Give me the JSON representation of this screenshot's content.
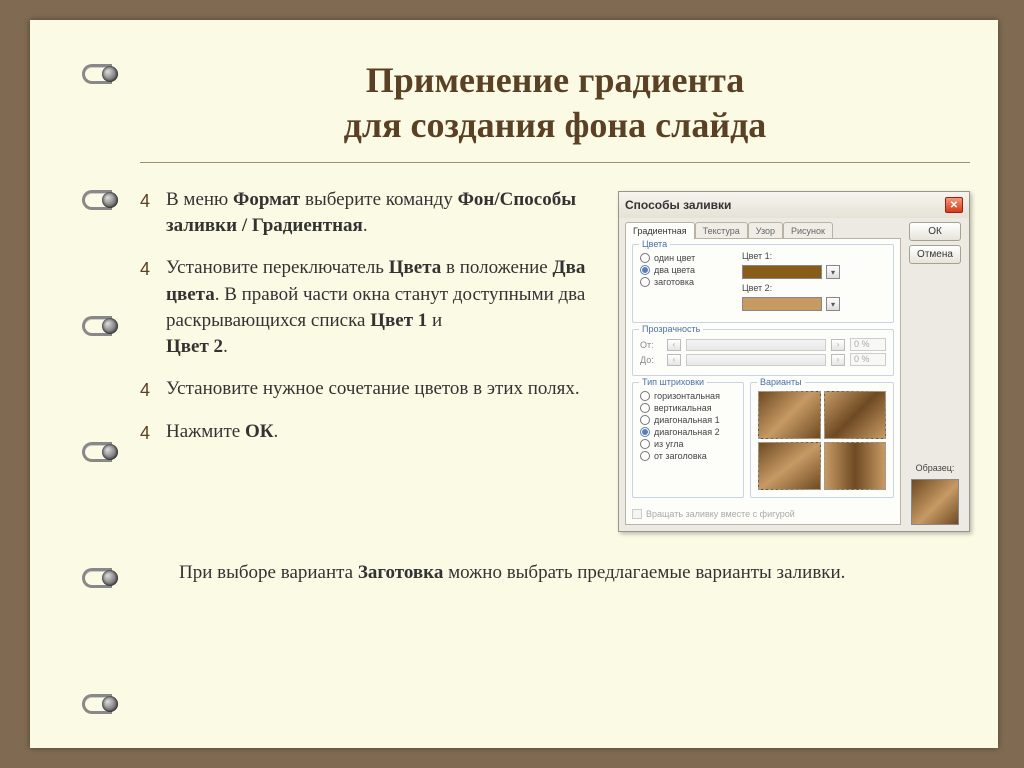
{
  "title_line1": "Применение градиента",
  "title_line2": "для создания фона слайда",
  "bullets": {
    "b1_pre": "В меню ",
    "b1_bold1": "Формат",
    "b1_mid": " выберите команду ",
    "b1_bold2": "Фон/Способы заливки / Градиентная",
    "b1_post": ".",
    "b2_pre": "Установите переключатель ",
    "b2_bold1": "Цвета",
    "b2_mid1": " в положение ",
    "b2_bold2": "Два цвета",
    "b2_mid2": ". В правой части окна станут доступными два раскрывающихся списка ",
    "b2_bold3": "Цвет 1",
    "b2_mid3": " и ",
    "b2_bold4": "Цвет 2",
    "b2_post": ".",
    "b3": "Установите нужное сочетание цветов в этих полях.",
    "b4_pre": "Нажмите ",
    "b4_bold": "ОК",
    "b4_post": "."
  },
  "footer": {
    "pre": "При выборе варианта ",
    "bold": "Заготовка",
    "post": " можно выбрать предлагаемые варианты заливки."
  },
  "dialog": {
    "title": "Способы заливки",
    "tabs": [
      "Градиентная",
      "Текстура",
      "Узор",
      "Рисунок"
    ],
    "buttons": {
      "ok": "ОК",
      "cancel": "Отмена"
    },
    "groups": {
      "colors": "Цвета",
      "transparency": "Прозрачность",
      "shading": "Тип штриховки",
      "variants": "Варианты"
    },
    "radios_color": [
      "один цвет",
      "два цвета",
      "заготовка"
    ],
    "color_labels": {
      "c1": "Цвет 1:",
      "c2": "Цвет 2:"
    },
    "color_values": {
      "c1": "#8a5c1a",
      "c2": "#c79a64"
    },
    "transparency": {
      "from": "От:",
      "to": "До:",
      "pct": "0 %"
    },
    "radios_shade": [
      "горизонтальная",
      "вертикальная",
      "диагональная 1",
      "диагональная 2",
      "из угла",
      "от заголовка"
    ],
    "rotate_label": "Вращать заливку вместе с фигурой",
    "sample_label": "Образец:"
  }
}
